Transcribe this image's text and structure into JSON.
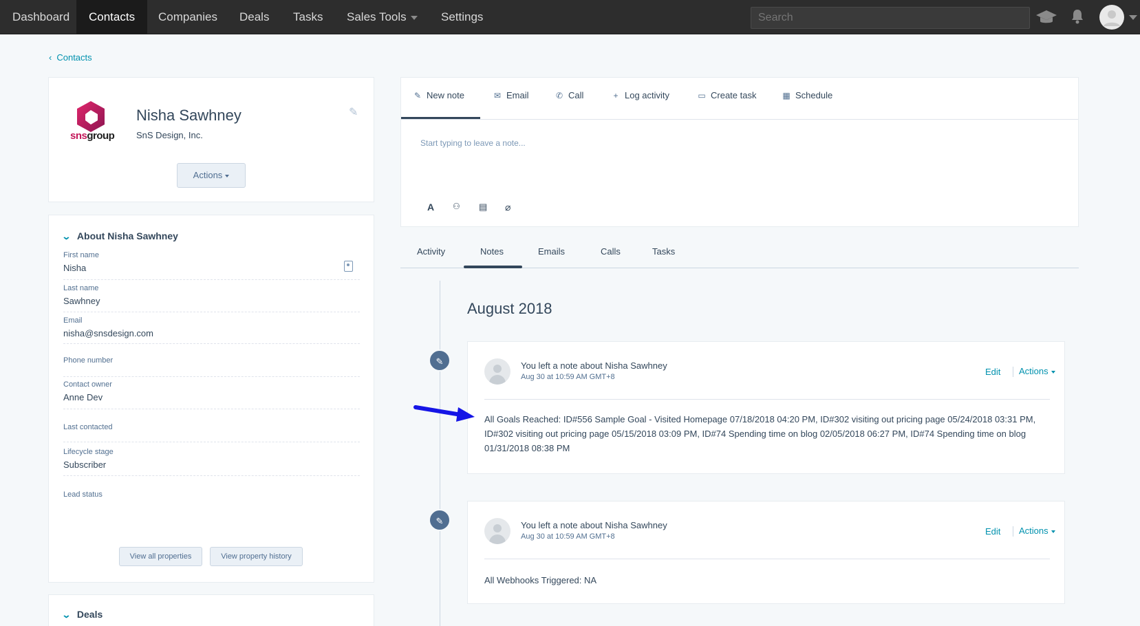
{
  "nav": {
    "items": [
      {
        "label": "Dashboard"
      },
      {
        "label": "Contacts"
      },
      {
        "label": "Companies"
      },
      {
        "label": "Deals"
      },
      {
        "label": "Tasks"
      },
      {
        "label": "Sales Tools"
      },
      {
        "label": "Settings"
      }
    ],
    "active": "Contacts",
    "search_placeholder": "Search",
    "icons": [
      "academy-icon",
      "notifications-icon",
      "user-avatar-icon"
    ]
  },
  "breadcrumb": {
    "label": "Contacts"
  },
  "profile": {
    "logo_text_a": "sns",
    "logo_text_b": "group",
    "name": "Nisha Sawhney",
    "company": "SnS Design, Inc.",
    "actions_label": "Actions"
  },
  "about": {
    "title": "About Nisha Sawhney",
    "properties": [
      {
        "label": "First name",
        "value": "Nisha"
      },
      {
        "label": "Last name",
        "value": "Sawhney"
      },
      {
        "label": "Email",
        "value": "nisha@snsdesign.com"
      },
      {
        "label": "Phone number",
        "value": ""
      },
      {
        "label": "Contact owner",
        "value": "Anne Dev"
      },
      {
        "label": "Last contacted",
        "value": ""
      },
      {
        "label": "Lifecycle stage",
        "value": "Subscriber"
      },
      {
        "label": "Lead status",
        "value": ""
      }
    ],
    "view_all_label": "View all properties",
    "view_history_label": "View property history"
  },
  "deals": {
    "title": "Deals"
  },
  "composer": {
    "tabs": [
      {
        "label": "New note",
        "icon": "edit-icon"
      },
      {
        "label": "Email",
        "icon": "email-icon"
      },
      {
        "label": "Call",
        "icon": "phone-icon"
      },
      {
        "label": "Log activity",
        "icon": "plus-icon"
      },
      {
        "label": "Create task",
        "icon": "task-icon"
      },
      {
        "label": "Schedule",
        "icon": "calendar-icon"
      }
    ],
    "placeholder": "Start typing to leave a note..."
  },
  "activity_tabs": {
    "items": [
      "Activity",
      "Notes",
      "Emails",
      "Calls",
      "Tasks"
    ],
    "active": "Notes"
  },
  "timeline": {
    "month": "August 2018",
    "notes": [
      {
        "prefix": "You left a note about ",
        "contact": "Nisha Sawhney",
        "time": "Aug 30 at 10:59 AM GMT+8",
        "edit_label": "Edit",
        "actions_label": "Actions",
        "body_lines": [
          "All Goals Reached: ID#556 Sample Goal - Visited Homepage 07/18/2018 04:20 PM, ID#302 visiting out pricing page 05/24/2018 03:31 PM,",
          "ID#302 visiting out pricing page 05/15/2018 03:09 PM, ID#74 Spending time on blog 02/05/2018 06:27 PM, ID#74 Spending time on blog",
          "01/31/2018 08:38 PM"
        ]
      },
      {
        "prefix": "You left a note about ",
        "contact": "Nisha Sawhney",
        "time": "Aug 30 at 10:59 AM GMT+8",
        "edit_label": "Edit",
        "actions_label": "Actions",
        "body_lines": [
          "All Webhooks Triggered: NA"
        ]
      }
    ]
  },
  "colors": {
    "nav_bg": "#2d2d2d",
    "link": "#0091ae",
    "brand_logo": "#c3185a",
    "annotation_arrow": "#1515e6"
  }
}
